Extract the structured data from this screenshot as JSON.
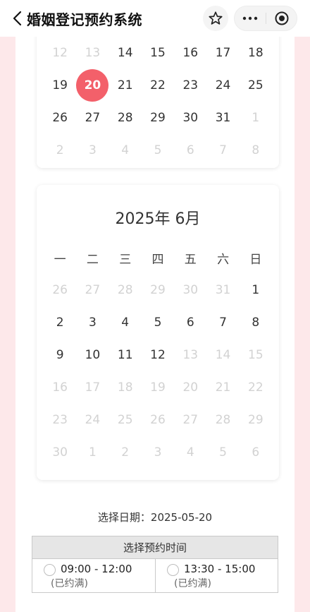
{
  "header": {
    "title": "婚姻登记预约系统"
  },
  "calendar_may": {
    "rows": [
      [
        {
          "d": "12",
          "f": true
        },
        {
          "d": "13",
          "f": true
        },
        {
          "d": "14",
          "f": false
        },
        {
          "d": "15",
          "f": false
        },
        {
          "d": "16",
          "f": false
        },
        {
          "d": "17",
          "f": false
        },
        {
          "d": "18",
          "f": false
        }
      ],
      [
        {
          "d": "19",
          "f": false
        },
        {
          "d": "20",
          "f": false,
          "s": true
        },
        {
          "d": "21",
          "f": false
        },
        {
          "d": "22",
          "f": false
        },
        {
          "d": "23",
          "f": false
        },
        {
          "d": "24",
          "f": false
        },
        {
          "d": "25",
          "f": false
        }
      ],
      [
        {
          "d": "26",
          "f": false
        },
        {
          "d": "27",
          "f": false
        },
        {
          "d": "28",
          "f": false
        },
        {
          "d": "29",
          "f": false
        },
        {
          "d": "30",
          "f": false
        },
        {
          "d": "31",
          "f": false
        },
        {
          "d": "1",
          "f": true
        }
      ],
      [
        {
          "d": "2",
          "f": true
        },
        {
          "d": "3",
          "f": true
        },
        {
          "d": "4",
          "f": true
        },
        {
          "d": "5",
          "f": true
        },
        {
          "d": "6",
          "f": true
        },
        {
          "d": "7",
          "f": true
        },
        {
          "d": "8",
          "f": true
        }
      ]
    ]
  },
  "calendar_june": {
    "title": "2025年 6月",
    "weekdays": [
      "一",
      "二",
      "三",
      "四",
      "五",
      "六",
      "日"
    ],
    "rows": [
      [
        {
          "d": "26",
          "f": true
        },
        {
          "d": "27",
          "f": true
        },
        {
          "d": "28",
          "f": true
        },
        {
          "d": "29",
          "f": true
        },
        {
          "d": "30",
          "f": true
        },
        {
          "d": "31",
          "f": true
        },
        {
          "d": "1",
          "f": false
        }
      ],
      [
        {
          "d": "2",
          "f": false
        },
        {
          "d": "3",
          "f": false
        },
        {
          "d": "4",
          "f": false
        },
        {
          "d": "5",
          "f": false
        },
        {
          "d": "6",
          "f": false
        },
        {
          "d": "7",
          "f": false
        },
        {
          "d": "8",
          "f": false
        }
      ],
      [
        {
          "d": "9",
          "f": false
        },
        {
          "d": "10",
          "f": false
        },
        {
          "d": "11",
          "f": false
        },
        {
          "d": "12",
          "f": false
        },
        {
          "d": "13",
          "f": true
        },
        {
          "d": "14",
          "f": true
        },
        {
          "d": "15",
          "f": true
        }
      ],
      [
        {
          "d": "16",
          "f": true
        },
        {
          "d": "17",
          "f": true
        },
        {
          "d": "18",
          "f": true
        },
        {
          "d": "19",
          "f": true
        },
        {
          "d": "20",
          "f": true
        },
        {
          "d": "21",
          "f": true
        },
        {
          "d": "22",
          "f": true
        }
      ],
      [
        {
          "d": "23",
          "f": true
        },
        {
          "d": "24",
          "f": true
        },
        {
          "d": "25",
          "f": true
        },
        {
          "d": "26",
          "f": true
        },
        {
          "d": "27",
          "f": true
        },
        {
          "d": "28",
          "f": true
        },
        {
          "d": "29",
          "f": true
        }
      ],
      [
        {
          "d": "30",
          "f": true
        },
        {
          "d": "1",
          "f": true
        },
        {
          "d": "2",
          "f": true
        },
        {
          "d": "3",
          "f": true
        },
        {
          "d": "4",
          "f": true
        },
        {
          "d": "5",
          "f": true
        },
        {
          "d": "6",
          "f": true
        }
      ]
    ]
  },
  "selection": {
    "date_text": "选择日期：2025-05-20"
  },
  "time_slots": {
    "header": "选择预约时间",
    "slots": [
      {
        "time": "09:00 - 12:00",
        "status": "(已约满)"
      },
      {
        "time": "13:30 - 15:00",
        "status": "(已约满)"
      }
    ]
  },
  "colors": {
    "accent": "#f3606a",
    "background": "#fde8ea"
  }
}
